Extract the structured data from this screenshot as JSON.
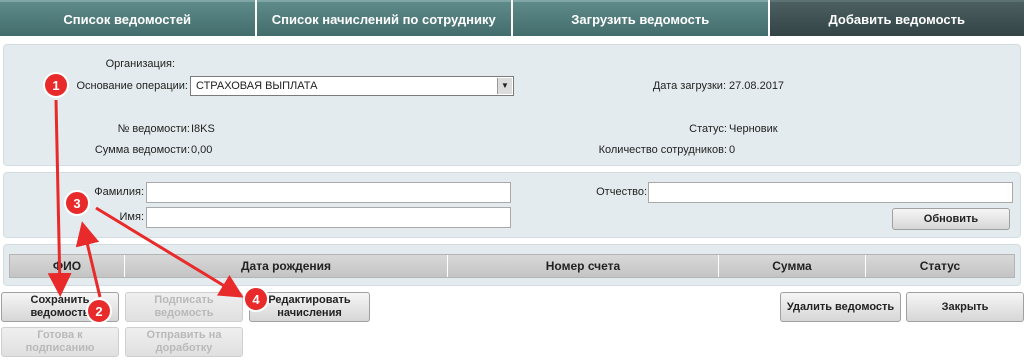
{
  "tabs": [
    {
      "label": "Список ведомостей",
      "active": false
    },
    {
      "label": "Список начислений по сотруднику",
      "active": false
    },
    {
      "label": "Загрузить ведомость",
      "active": false
    },
    {
      "label": "Добавить ведомость",
      "active": true
    }
  ],
  "info": {
    "organization_label": "Организация:",
    "operation_label": "Основание операции:",
    "operation_value": "СТРАХОВАЯ ВЫПЛАТА",
    "upload_date_label": "Дата загрузки:",
    "upload_date_value": "27.08.2017",
    "statement_number_label": "№ ведомости:",
    "statement_number_value": "I8KS",
    "status_label": "Статус:",
    "status_value": "Черновик",
    "sum_label": "Сумма ведомости:",
    "sum_value": "0,00",
    "employees_label": "Количество сотрудников:",
    "employees_value": "0"
  },
  "filter": {
    "last_name_label": "Фамилия:",
    "last_name_value": "",
    "first_name_label": "Имя:",
    "first_name_value": "",
    "patronymic_label": "Отчество:",
    "patronymic_value": "",
    "refresh_label": "Обновить"
  },
  "table": {
    "columns": [
      "ФИО",
      "Дата рождения",
      "Номер счета",
      "Сумма",
      "Статус"
    ]
  },
  "actions": {
    "save": "Сохранить ведомость",
    "sign": "Подписать ведомость",
    "edit": "Редактировать начисления",
    "ready": "Готова к подписанию",
    "send_back": "Отправить на доработку",
    "delete": "Удалить ведомость",
    "close": "Закрыть"
  },
  "annotations": [
    "1",
    "2",
    "3",
    "4"
  ],
  "colors": {
    "tab": "#4f7a7a",
    "tab_active": "#3b4e50",
    "panel": "#e4ebee",
    "annotation": "#e82a2a"
  }
}
